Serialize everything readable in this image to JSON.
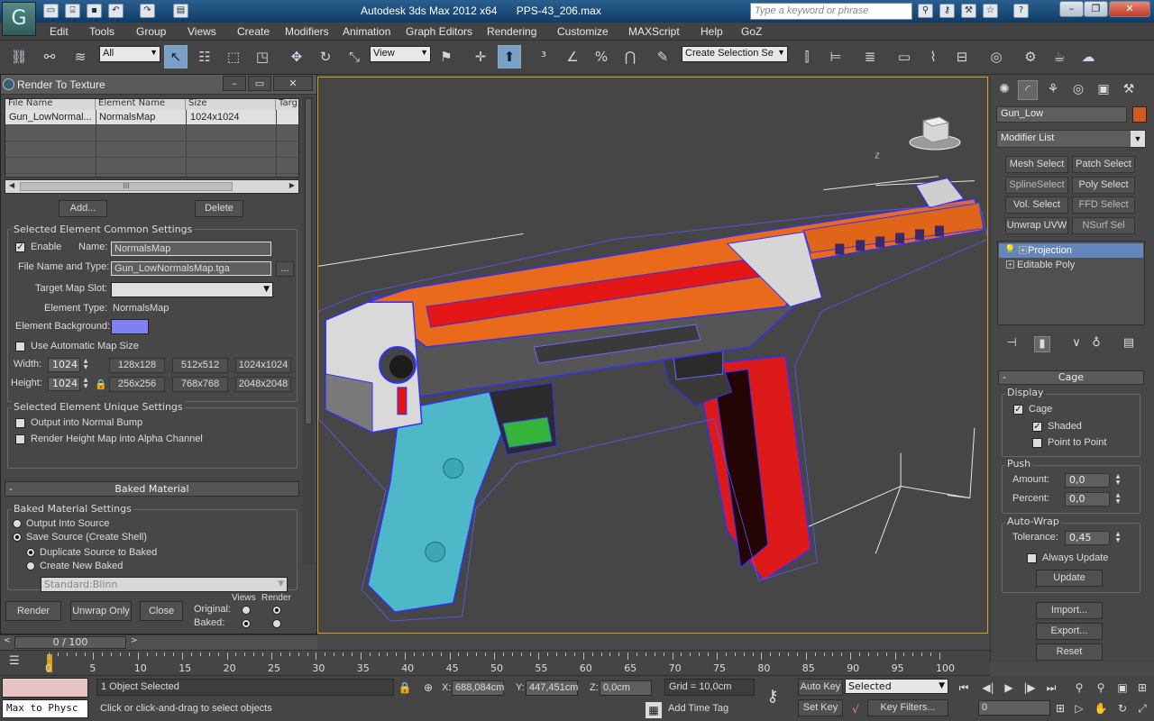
{
  "titlebar": {
    "app_title": "Autodesk 3ds Max  2012 x64",
    "file_name": "PPS-43_206.max",
    "search_placeholder": "Type a keyword or phrase"
  },
  "menu": {
    "items": [
      "Edit",
      "Tools",
      "Group",
      "Views",
      "Create",
      "Modifiers",
      "Animation",
      "Graph Editors",
      "Rendering",
      "Customize",
      "MAXScript",
      "Help",
      "GoZ"
    ]
  },
  "toolbar": {
    "selection_filter": "All",
    "ref_coord": "View",
    "named_selection": "Create Selection Se"
  },
  "render_to_texture": {
    "title": "Render To Texture",
    "columns": [
      "File Name",
      "Element Name",
      "Size",
      "Targ"
    ],
    "rows": [
      {
        "file": "Gun_LowNormal...",
        "element": "NormalsMap",
        "size": "1024x1024"
      }
    ],
    "add_label": "Add...",
    "delete_label": "Delete",
    "common_settings": {
      "group_label": "Selected Element Common Settings",
      "enable_label": "Enable",
      "name_label": "Name:",
      "name_value": "NormalsMap",
      "file_label": "File Name and Type:",
      "file_value": "Gun_LowNormalsMap.tga",
      "browse_label": "...",
      "target_slot_label": "Target Map Slot:",
      "element_type_label": "Element Type:",
      "element_type_value": "NormalsMap",
      "bg_label": "Element Background:",
      "bg_color": "#8080f0",
      "auto_size_label": "Use Automatic Map Size",
      "width_label": "Width:",
      "width_value": "1024",
      "height_label": "Height:",
      "height_value": "1024",
      "sizes": [
        "128x128",
        "512x512",
        "1024x1024",
        "256x256",
        "768x768",
        "2048x2048"
      ]
    },
    "unique_settings": {
      "group_label": "Selected Element Unique Settings",
      "normal_bump_label": "Output into Normal Bump",
      "height_alpha_label": "Render Height Map into Alpha Channel"
    },
    "baked_material": {
      "rollout_label": "Baked Material",
      "group_label": "Baked Material Settings",
      "output_source_label": "Output Into Source",
      "save_source_label": "Save Source (Create Shell)",
      "duplicate_label": "Duplicate Source to Baked",
      "create_new_label": "Create New Baked",
      "material_value": "Standard:Blinn"
    },
    "footer": {
      "render_label": "Render",
      "unwrap_label": "Unwrap Only",
      "close_label": "Close",
      "original_label": "Original:",
      "baked_label": "Baked:",
      "views_label": "Views",
      "render_col_label": "Render"
    }
  },
  "command_panel": {
    "object_name": "Gun_Low",
    "object_color": "#d05a1c",
    "modifier_list_label": "Modifier List",
    "modifier_buttons": [
      "Mesh Select",
      "Patch Select",
      "SplineSelect",
      "Poly Select",
      "Vol. Select",
      "FFD Select",
      "Unwrap UVW",
      "NSurf Sel"
    ],
    "stack": [
      "Projection",
      "Editable Poly"
    ],
    "cage": {
      "rollout_label": "Cage",
      "display_label": "Display",
      "cage_label": "Cage",
      "shaded_label": "Shaded",
      "p2p_label": "Point to Point",
      "push_label": "Push",
      "amount_label": "Amount:",
      "amount_value": "0,0",
      "percent_label": "Percent:",
      "percent_value": "0,0",
      "autowrap_label": "Auto-Wrap",
      "tolerance_label": "Tolerance:",
      "tolerance_value": "0,45",
      "always_update_label": "Always Update",
      "update_label": "Update",
      "import_label": "Import...",
      "export_label": "Export...",
      "reset_label": "Reset"
    }
  },
  "timeline": {
    "frame_display": "0 / 100",
    "ticks": [
      "0",
      "5",
      "10",
      "15",
      "20",
      "25",
      "30",
      "35",
      "40",
      "45",
      "50",
      "55",
      "60",
      "65",
      "70",
      "75",
      "80",
      "85",
      "90",
      "95",
      "100"
    ]
  },
  "status": {
    "maxscript_text": "Max to Physc",
    "selection_text": "1 Object Selected",
    "prompt_text": "Click or click-and-drag to select objects",
    "x_label": "X:",
    "x_value": "688,084cm",
    "y_label": "Y:",
    "y_value": "447,451cm",
    "z_label": "Z:",
    "z_value": "0,0cm",
    "grid_text": "Grid = 10,0cm",
    "add_time_tag": "Add Time Tag",
    "auto_key": "Auto Key",
    "set_key": "Set Key",
    "key_mode_value": "Selected",
    "key_filters": "Key Filters...",
    "frame_value": "0"
  },
  "viewport": {
    "axis_label": "Z"
  }
}
